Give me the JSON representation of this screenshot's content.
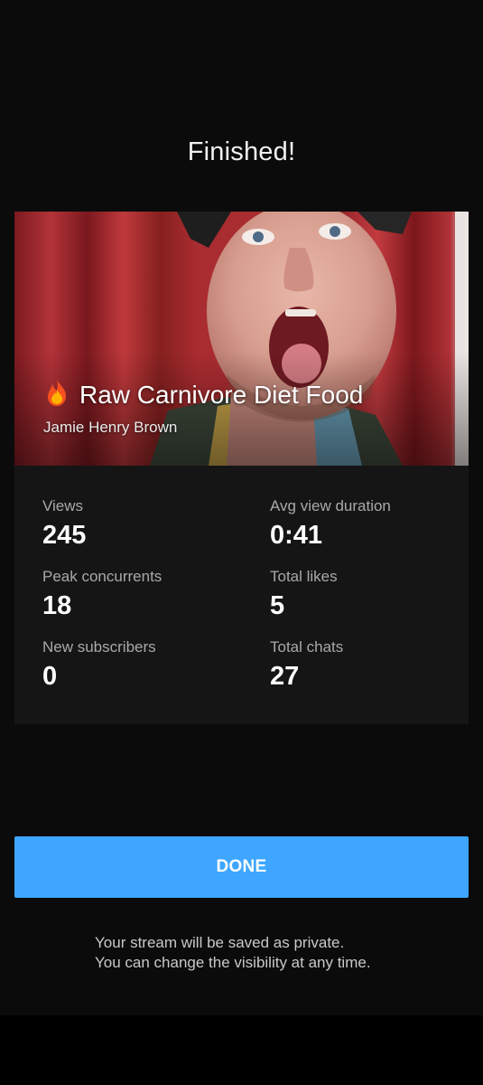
{
  "screen": {
    "title": "Finished!"
  },
  "stream": {
    "title_emoji": "🔥",
    "title": "Raw Carnivore Diet Food",
    "channel": "Jamie Henry Brown"
  },
  "stats": [
    {
      "label": "Views",
      "value": "245"
    },
    {
      "label": "Avg view duration",
      "value": "0:41"
    },
    {
      "label": "Peak concurrents",
      "value": "18"
    },
    {
      "label": "Total likes",
      "value": "5"
    },
    {
      "label": "New subscribers",
      "value": "0"
    },
    {
      "label": "Total chats",
      "value": "27"
    }
  ],
  "actions": {
    "done_label": "DONE"
  },
  "note": {
    "line1": "Your stream will be saved as private.",
    "line2": "You can change the visibility at any time."
  },
  "colors": {
    "background": "#0b0b0b",
    "card": "#151515",
    "accent": "#3ea6ff",
    "label_text": "#a9a9a9"
  }
}
